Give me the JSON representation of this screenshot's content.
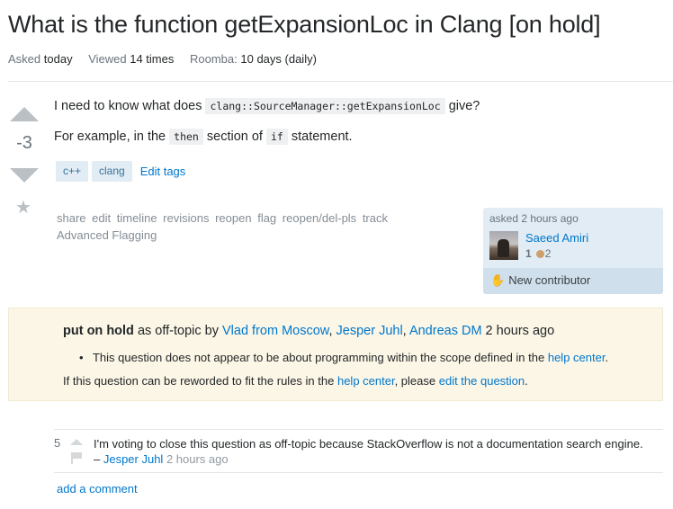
{
  "question": {
    "title": "What is the function getExpansionLoc in Clang [on hold]",
    "meta": [
      {
        "label": "Asked",
        "value": "today"
      },
      {
        "label": "Viewed",
        "value": "14 times"
      },
      {
        "label": "Roomba:",
        "value": "10 days (daily)"
      }
    ],
    "score": "-3",
    "body": {
      "p1_before": "I need to know what does ",
      "p1_code": "clang::SourceManager::getExpansionLoc",
      "p1_after": " give?",
      "p2_before": "For example, in the ",
      "p2_code1": "then",
      "p2_mid": " section of ",
      "p2_code2": "if",
      "p2_after": " statement."
    },
    "tags": [
      "c++",
      "clang"
    ],
    "edit_tags_label": "Edit tags",
    "menu": [
      "share",
      "edit",
      "timeline",
      "revisions",
      "reopen",
      "flag",
      "reopen/del-pls",
      "track",
      "Advanced Flagging"
    ]
  },
  "owner": {
    "asked": "asked 2 hours ago",
    "name": "Saeed Amiri",
    "reputation": "1",
    "bronze_badges": "2",
    "new_contributor": "New contributor"
  },
  "hold_notice": {
    "status": "put on hold",
    "as": " as off-topic by ",
    "voters": [
      "Vlad from Moscow",
      "Jesper Juhl",
      "Andreas DM"
    ],
    "time": " 2 hours ago",
    "reason_text": "This question does not appear to be about programming within the scope defined in the ",
    "reason_link": "help center",
    "reword_before": "If this question can be reworded to fit the rules in the ",
    "reword_link1": "help center",
    "reword_mid": ", please ",
    "reword_link2": "edit the question",
    "reword_end": "."
  },
  "comments": [
    {
      "score": "5",
      "text": "I'm voting to close this question as off-topic because StackOverflow is not a documentation search engine.",
      "dash": " – ",
      "author": "Jesper Juhl",
      "date": "2 hours ago"
    }
  ],
  "add_comment_label": "add a comment"
}
